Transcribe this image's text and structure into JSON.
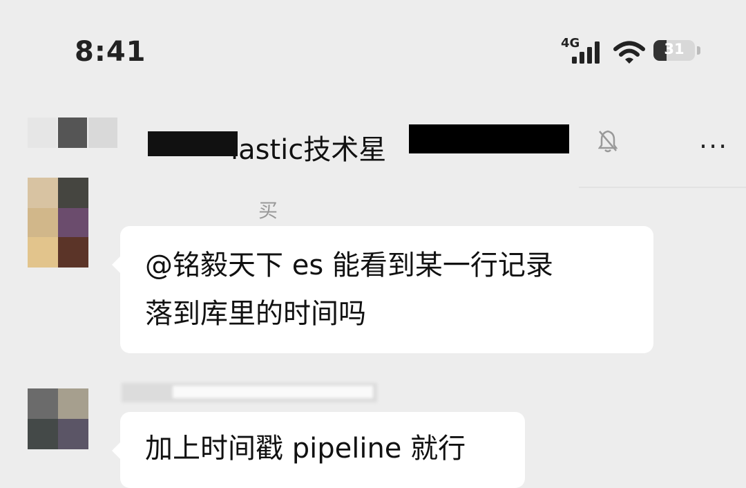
{
  "status_bar": {
    "time": "8:41",
    "network": "4G",
    "battery": "31",
    "battery_level_percent": 31
  },
  "chat_header": {
    "title_visible": "lastic技术星",
    "icons": [
      "mute-bell-icon",
      "more-icon"
    ],
    "more_label": "···"
  },
  "messages": [
    {
      "sender": "买",
      "lines": [
        "@铭毅天下  es 能看到某一行记录",
        "落到库里的时间吗"
      ],
      "avatar_colors": [
        "#d8c3a2",
        "#454540",
        "#d1b78a",
        "#6b4c6d",
        "#e2c48c",
        "#5b3428"
      ]
    },
    {
      "sender": "",
      "lines": [
        "加上时间戳 pipeline 就行"
      ],
      "avatar_colors": [
        "#6b6b6b",
        "#a69f8e",
        "#444948",
        "#5b5566"
      ]
    }
  ],
  "colors": {
    "background": "#ededed",
    "bubble": "#ffffff",
    "redaction": "#000000"
  }
}
